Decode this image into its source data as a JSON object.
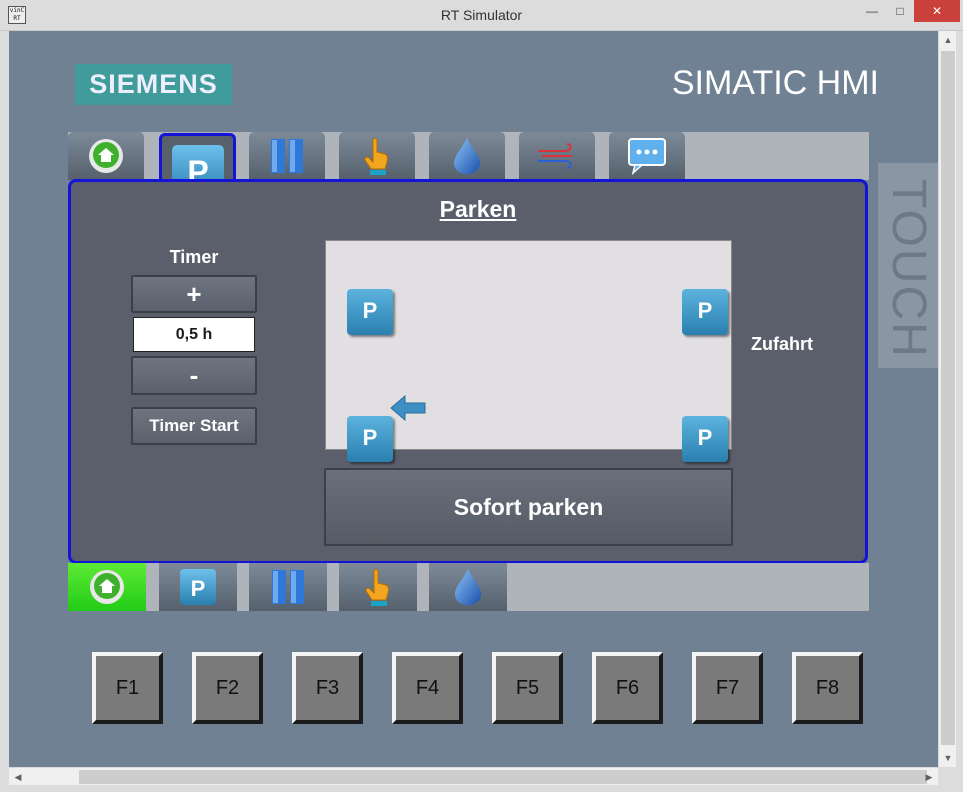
{
  "window": {
    "title": "RT Simulator",
    "icon_text_line1": "vinC",
    "icon_text_line2": "RT",
    "controls": [
      "minimize-icon",
      "maximize-icon",
      "close-icon"
    ]
  },
  "header": {
    "brand": "SIEMENS",
    "product": "SIMATIC HMI",
    "side_label": "TOUCH"
  },
  "tabs": [
    {
      "id": "home",
      "icon": "home-icon"
    },
    {
      "id": "parken",
      "icon": "parking-icon",
      "label": "P",
      "active": true
    },
    {
      "id": "pause",
      "icon": "pause-icon"
    },
    {
      "id": "touch",
      "icon": "hand-pointer-icon"
    },
    {
      "id": "water",
      "icon": "water-drop-icon"
    },
    {
      "id": "air",
      "icon": "airflow-icon"
    },
    {
      "id": "messages",
      "icon": "message-bubble-icon"
    }
  ],
  "panel": {
    "title": "Parken",
    "timer": {
      "label": "Timer",
      "plus_label": "+",
      "value": "0,5 h",
      "minus_label": "-",
      "start_label": "Timer Start"
    },
    "parking_slots": {
      "label": "P"
    },
    "entrance_label": "Zufahrt",
    "park_now_label": "Sofort parken"
  },
  "bottom_nav": [
    {
      "id": "home",
      "icon": "home-icon",
      "active": true
    },
    {
      "id": "parken",
      "icon": "parking-icon",
      "label": "P"
    },
    {
      "id": "pause",
      "icon": "pause-icon"
    },
    {
      "id": "touch",
      "icon": "hand-pointer-icon"
    },
    {
      "id": "water",
      "icon": "water-drop-icon"
    }
  ],
  "function_keys": [
    "F1",
    "F2",
    "F3",
    "F4",
    "F5",
    "F6",
    "F7",
    "F8"
  ],
  "colors": {
    "background": "#6f8192",
    "panel": "#5a5f6b",
    "active_border": "#1414d8",
    "siemens_teal": "#3f9c9b",
    "home_active_green": "#22cc18",
    "parking_blue": "#2a7fb0"
  }
}
